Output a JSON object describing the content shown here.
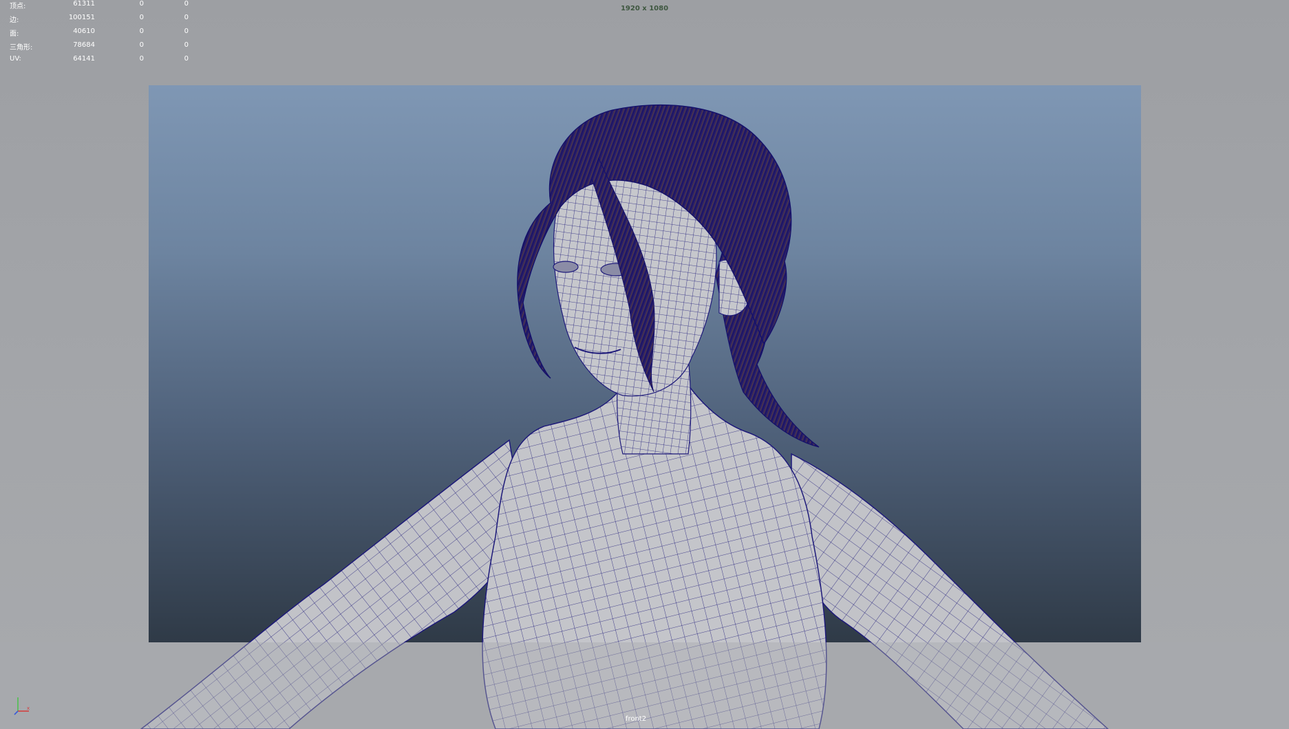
{
  "hud": {
    "resolution": "1920 x 1080",
    "camera": "front2",
    "stats": [
      {
        "label": "顶点:",
        "value": "61311",
        "selected": "0",
        "triangles": "0"
      },
      {
        "label": "边:",
        "value": "100151",
        "selected": "0",
        "triangles": "0"
      },
      {
        "label": "面:",
        "value": "40610",
        "selected": "0",
        "triangles": "0"
      },
      {
        "label": "三角形:",
        "value": "78684",
        "selected": "0",
        "triangles": "0"
      },
      {
        "label": "UV:",
        "value": "64141",
        "selected": "0",
        "triangles": "0"
      }
    ]
  },
  "axis_indicator": {
    "icon": "view-axis-icon",
    "labels": [
      "Y",
      "X",
      "Z"
    ]
  },
  "colors": {
    "viewport_bg": "#a7a9ad",
    "gate_top": "#7f97b4",
    "gate_bottom": "#2f3a47",
    "wireframe": "#1e1a7a",
    "skin": "#c9c9ce",
    "hair": "#6b4a2a"
  }
}
